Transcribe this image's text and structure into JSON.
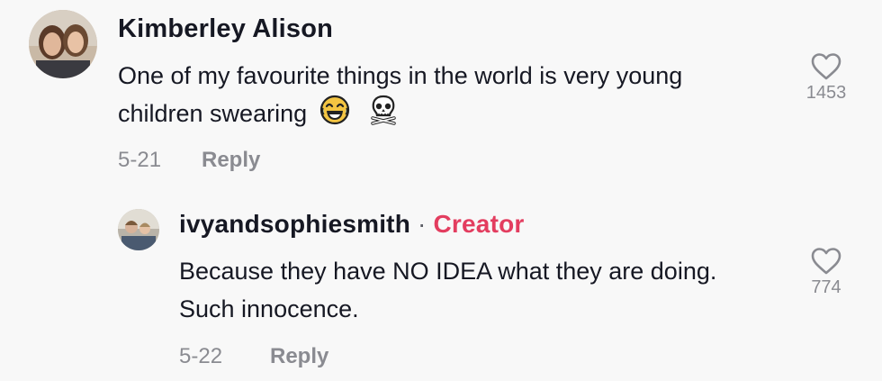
{
  "comments": [
    {
      "username": "Kimberley Alison",
      "text_line1": "One of my favourite things in the world is very young",
      "text_line2": "children swearing",
      "emojis": [
        "face-with-tears-of-joy",
        "skull-and-crossbones"
      ],
      "date": "5-21",
      "reply_label": "Reply",
      "like_count": "1453"
    }
  ],
  "replies": [
    {
      "username": "ivyandsophiesmith",
      "separator": "·",
      "badge": "Creator",
      "text_line1": "Because they have NO IDEA what they are doing.",
      "text_line2": "Such innocence.",
      "date": "5-22",
      "reply_label": "Reply",
      "like_count": "774"
    }
  ],
  "icons": {
    "like": "heart-outline-icon"
  },
  "colors": {
    "background": "#f8f8f8",
    "text": "#161823",
    "muted": "#8a8b91",
    "creator": "#e33d5f"
  }
}
